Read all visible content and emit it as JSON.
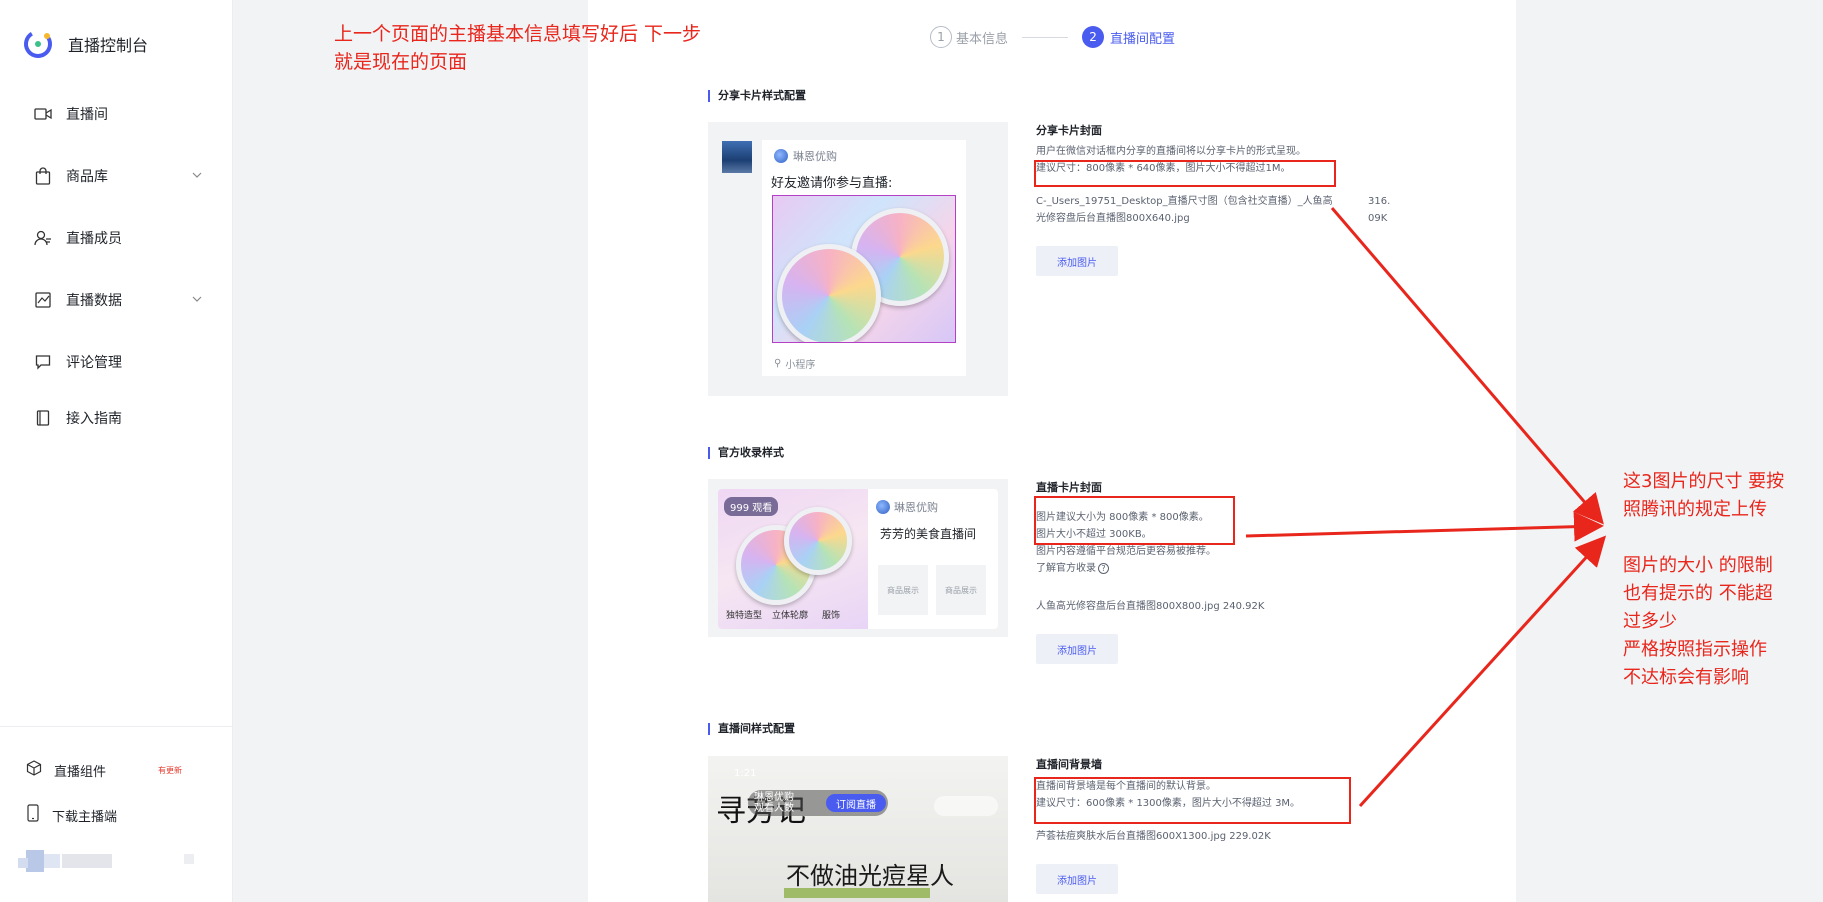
{
  "sidebar": {
    "title": "直播控制台",
    "items": [
      {
        "label": "直播间",
        "icon": "video-icon"
      },
      {
        "label": "商品库",
        "icon": "bag-icon"
      },
      {
        "label": "直播成员",
        "icon": "user-icon"
      },
      {
        "label": "直播数据",
        "icon": "chart-icon"
      },
      {
        "label": "评论管理",
        "icon": "comment-icon"
      },
      {
        "label": "接入指南",
        "icon": "book-icon"
      }
    ],
    "bottom": [
      {
        "label": "直播组件",
        "icon": "cube-icon",
        "badge": "有更新"
      },
      {
        "label": "下载主播端",
        "icon": "phone-icon"
      }
    ]
  },
  "steps": [
    {
      "num": "1",
      "label": "基本信息"
    },
    {
      "num": "2",
      "label": "直播间配置"
    }
  ],
  "share": {
    "section_title": "分享卡片样式配置",
    "shop_name": "琳恩优购",
    "card_headline": "好友邀请你参与直播:",
    "mini_program": "小程序",
    "field_title": "分享卡片封面",
    "desc_1": "用户在微信对话框内分享的直播间将以分享卡片的形式呈现。",
    "desc_2": "建议尺寸：800像素 * 640像素，图片大小不得超过1M。",
    "file_name_1": "C-_Users_19751_Desktop_直播尺寸图（包含社交直播）_人鱼高",
    "file_name_2": "光修容盘后台直播图800X640.jpg",
    "file_size_1": "316.",
    "file_size_2": "09K",
    "add_button": "添加图片"
  },
  "official": {
    "section_title": "官方收录样式",
    "viewer_tag": "999 观看",
    "shop_name": "琳恩优购",
    "room_title": "芳芳的美食直播间",
    "goods_placeholder": "商品展示",
    "feat_1": "独特造型",
    "feat_2": "立体轮廓",
    "feat_3": "服饰",
    "field_title": "直播卡片封面",
    "desc_1": "图片建议大小为 800像素 * 800像素。",
    "desc_2": "图片大小不超过 300KB。",
    "desc_3": "图片内容遵循平台规范后更容易被推荐。",
    "desc_4": "了解官方收录",
    "file_line": "人鱼高光修容盘后台直播图800X800.jpg   240.92K",
    "add_button": "添加图片"
  },
  "liveroom": {
    "section_title": "直播间样式配置",
    "status_time": "1:21",
    "host_name": "琳恩优购",
    "host_sub": "观看人数",
    "subscribe_button": "订阅直播",
    "brand_text": "寻芳记",
    "slogan": "不做油光痘星人",
    "field_title": "直播间背景墙",
    "desc_1": "直播间背景墙是每个直播间的默认背景。",
    "desc_2": "建议尺寸：600像素 * 1300像素，图片大小不得超过 3M。",
    "file_line": "芦荟祛痘爽肤水后台直播图600X1300.jpg   229.02K",
    "add_button": "添加图片"
  },
  "annotations": {
    "top_1": "上一个页面的主播基本信息填写好后 下一步",
    "top_2": "就是现在的页面",
    "right_1": "这3图片的尺寸 要按",
    "right_2": "照腾讯的规定上传",
    "right_3": "图片的大小 的限制",
    "right_4": "也有提示的 不能超",
    "right_5": "过多少",
    "right_6": "严格按照指示操作",
    "right_7": "不达标会有影响"
  },
  "colors": {
    "accent": "#4a5cf0",
    "annotation": "#e8261c"
  }
}
